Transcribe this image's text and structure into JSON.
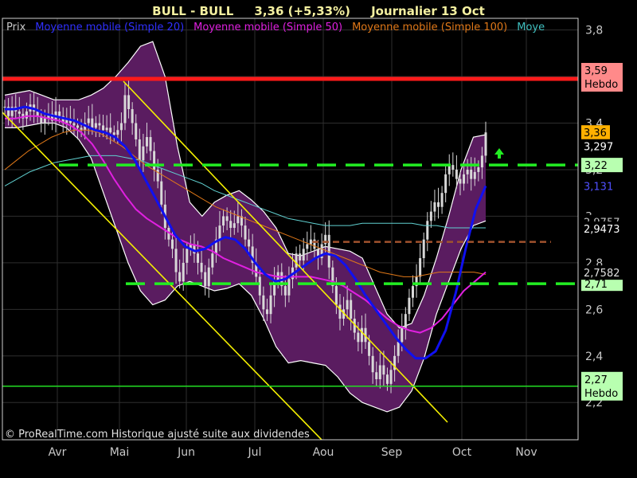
{
  "header": {
    "symbol": "BULL - BULL",
    "quote": "3,36 (+5,33%)",
    "period": "Journalier  13 Oct"
  },
  "footer": {
    "copyright": "© ProRealTime.com Historique ajusté suite aux dividendes"
  },
  "colors": {
    "background": "#000000",
    "frame": "#d0d0d0",
    "grid": "#2e2e2e",
    "band_fill": "#5a1c60",
    "band_edge": "#ffffff",
    "candle": "#d8d8d8",
    "ma20": "#1010f0",
    "ma50": "#e020e0",
    "ma100": "#e07818",
    "ma200": "#60d0d0",
    "resistance_red": "#ff1a1a",
    "support_green": "#22dd22",
    "dashed_green": "#22ee22",
    "dashed_brown": "#a0522d",
    "trend_yellow": "#f4f000"
  },
  "chart_data": {
    "type": "candlestick",
    "title": "BULL - BULL",
    "ylim": [
      2.04,
      3.85
    ],
    "y_ticks": [
      {
        "value": 3.8,
        "label": "3,8"
      },
      {
        "value": 3.6,
        "label": "3,6"
      },
      {
        "value": 3.4,
        "label": "3,4"
      },
      {
        "value": 3.2,
        "label": "3,2"
      },
      {
        "value": 3.0,
        "label": "3"
      },
      {
        "value": 2.8,
        "label": "2,8"
      },
      {
        "value": 2.6,
        "label": "2,6"
      },
      {
        "value": 2.4,
        "label": "2,4"
      },
      {
        "value": 2.2,
        "label": "2,2"
      }
    ],
    "x_ticks": [
      "Avr",
      "Mai",
      "Jun",
      "Jul",
      "Aou",
      "Sep",
      "Oct",
      "Nov"
    ],
    "legend": [
      {
        "label": "Prix",
        "color": "#c8c8c8"
      },
      {
        "label": "Moyenne mobile (Simple 20)",
        "color": "#3030ff"
      },
      {
        "label": "Moyenne mobile (Simple 50)",
        "color": "#e020e0"
      },
      {
        "label": "Moyenne mobile (Simple 100)",
        "color": "#e07818"
      },
      {
        "label": "Moye",
        "color": "#40c0c0"
      }
    ],
    "series": [
      {
        "name": "Prix",
        "close": [
          3.47,
          3.43,
          3.47,
          3.45,
          3.44,
          3.42,
          3.45,
          3.48,
          3.45,
          3.43,
          3.4,
          3.42,
          3.44,
          3.41,
          3.45,
          3.43,
          3.4,
          3.42,
          3.4,
          3.39,
          3.38,
          3.37,
          3.4,
          3.42,
          3.38,
          3.4,
          3.39,
          3.37,
          3.38,
          3.36,
          3.35,
          3.37,
          3.4,
          3.52,
          3.46,
          3.4,
          3.33,
          3.24,
          3.3,
          3.34,
          3.28,
          3.2,
          3.15,
          3.05,
          2.95,
          2.9,
          2.86,
          2.76,
          2.72,
          2.8,
          2.86,
          2.88,
          2.84,
          2.8,
          2.76,
          2.7,
          2.78,
          2.84,
          2.9,
          2.96,
          3.0,
          2.98,
          2.95,
          2.97,
          3.0,
          2.96,
          2.9,
          2.87,
          2.8,
          2.74,
          2.66,
          2.6,
          2.58,
          2.66,
          2.72,
          2.76,
          2.7,
          2.66,
          2.73,
          2.78,
          2.84,
          2.81,
          2.86,
          2.88,
          2.9,
          2.86,
          2.82,
          2.88,
          2.92,
          2.78,
          2.7,
          2.62,
          2.56,
          2.6,
          2.64,
          2.56,
          2.5,
          2.46,
          2.52,
          2.46,
          2.4,
          2.33,
          2.3,
          2.36,
          2.32,
          2.28,
          2.34,
          2.4,
          2.46,
          2.52,
          2.58,
          2.65,
          2.7,
          2.74,
          2.82,
          2.9,
          2.98,
          3.02,
          3.06,
          3.04,
          3.1,
          3.18,
          3.22,
          3.2,
          3.16,
          3.14,
          3.18,
          3.2,
          3.16,
          3.19,
          3.21,
          3.26,
          3.36
        ]
      },
      {
        "name": "Moyenne mobile (Simple 20)",
        "values": [
          3.46,
          3.46,
          3.47,
          3.46,
          3.44,
          3.43,
          3.42,
          3.41,
          3.39,
          3.37,
          3.36,
          3.34,
          3.3,
          3.24,
          3.16,
          3.08,
          3.0,
          2.92,
          2.87,
          2.85,
          2.86,
          2.89,
          2.91,
          2.9,
          2.86,
          2.8,
          2.75,
          2.72,
          2.73,
          2.76,
          2.79,
          2.82,
          2.84,
          2.83,
          2.79,
          2.73,
          2.66,
          2.6,
          2.54,
          2.48,
          2.43,
          2.39,
          2.39,
          2.42,
          2.51,
          2.67,
          2.86,
          3.03,
          3.13
        ]
      },
      {
        "name": "Moyenne mobile (Simple 50)",
        "values": [
          3.42,
          3.42,
          3.43,
          3.43,
          3.42,
          3.41,
          3.39,
          3.36,
          3.31,
          3.24,
          3.16,
          3.09,
          3.03,
          2.99,
          2.96,
          2.93,
          2.9,
          2.88,
          2.87,
          2.85,
          2.82,
          2.8,
          2.78,
          2.76,
          2.75,
          2.74,
          2.74,
          2.74,
          2.74,
          2.73,
          2.72,
          2.7,
          2.67,
          2.64,
          2.6,
          2.56,
          2.53,
          2.51,
          2.5,
          2.52,
          2.56,
          2.62,
          2.68,
          2.72,
          2.76
        ]
      },
      {
        "name": "Moyenne mobile (Simple 100)",
        "values": [
          3.2,
          3.24,
          3.28,
          3.31,
          3.34,
          3.36,
          3.37,
          3.37,
          3.36,
          3.33,
          3.3,
          3.26,
          3.22,
          3.19,
          3.16,
          3.13,
          3.1,
          3.07,
          3.04,
          3.02,
          3.0,
          2.98,
          2.96,
          2.94,
          2.92,
          2.9,
          2.88,
          2.86,
          2.84,
          2.82,
          2.8,
          2.78,
          2.76,
          2.75,
          2.74,
          2.74,
          2.75,
          2.76,
          2.76,
          2.76,
          2.76,
          2.75
        ]
      },
      {
        "name": "Moye",
        "values": [
          3.13,
          3.16,
          3.19,
          3.21,
          3.23,
          3.24,
          3.25,
          3.26,
          3.26,
          3.26,
          3.25,
          3.24,
          3.22,
          3.2,
          3.18,
          3.16,
          3.14,
          3.11,
          3.09,
          3.07,
          3.05,
          3.03,
          3.01,
          2.99,
          2.98,
          2.97,
          2.96,
          2.96,
          2.96,
          2.97,
          2.97,
          2.97,
          2.97,
          2.97,
          2.96,
          2.96,
          2.95,
          2.95,
          2.95,
          2.95
        ]
      },
      {
        "name": "Bollinger upper",
        "values": [
          3.52,
          3.53,
          3.54,
          3.52,
          3.5,
          3.5,
          3.5,
          3.52,
          3.55,
          3.6,
          3.66,
          3.73,
          3.75,
          3.6,
          3.3,
          3.06,
          3.0,
          3.06,
          3.09,
          3.11,
          3.07,
          3.02,
          2.95,
          2.84,
          2.83,
          2.85,
          2.87,
          2.86,
          2.85,
          2.82,
          2.7,
          2.58,
          2.52,
          2.54,
          2.66,
          2.82,
          3.0,
          3.2,
          3.34,
          3.35
        ]
      },
      {
        "name": "Bollinger lower",
        "values": [
          3.38,
          3.38,
          3.39,
          3.4,
          3.4,
          3.38,
          3.33,
          3.25,
          3.1,
          2.95,
          2.8,
          2.68,
          2.62,
          2.64,
          2.7,
          2.72,
          2.7,
          2.68,
          2.69,
          2.71,
          2.66,
          2.56,
          2.44,
          2.37,
          2.38,
          2.37,
          2.36,
          2.31,
          2.24,
          2.2,
          2.18,
          2.16,
          2.18,
          2.25,
          2.39,
          2.58,
          2.72,
          2.86,
          2.96,
          2.98
        ]
      }
    ],
    "levels": [
      {
        "name": "resistance-hebdo",
        "value": 3.59,
        "label": "3,59",
        "sub": "Hebdo",
        "style": "solid-red"
      },
      {
        "name": "support-hebdo",
        "value": 2.27,
        "label": "2,27",
        "sub": "Hebdo",
        "style": "solid-green"
      },
      {
        "name": "dashed-upper",
        "value": 3.22,
        "label": "3,22",
        "style": "dashed-green"
      },
      {
        "name": "dashed-lower",
        "value": 2.71,
        "label": "2,71",
        "style": "dashed-green"
      },
      {
        "name": "dashed-mid",
        "value": 2.89,
        "style": "dashed-brown"
      }
    ],
    "price_tags": [
      {
        "name": "last-price",
        "value": 3.36,
        "label": "3,36",
        "fg": "#000000",
        "bg": "#ffb000"
      },
      {
        "name": "ma-boll-upper",
        "value": 3.3,
        "label": "3,297",
        "fg": "#ffffff",
        "bg": "#000000"
      },
      {
        "name": "ma20-value",
        "value": 3.13,
        "label": "3,131",
        "fg": "#5050ff",
        "bg": "#000000"
      },
      {
        "name": "ma200-prev",
        "value": 2.975,
        "label": "2,9757",
        "fg": "#c0c0c0",
        "bg": "#000000"
      },
      {
        "name": "ma200-value",
        "value": 2.947,
        "label": "2,9473",
        "fg": "#ffffff",
        "bg": "#000000"
      },
      {
        "name": "ma100-value",
        "value": 2.758,
        "label": "2,7582",
        "fg": "#e0e0e0",
        "bg": "#000000"
      }
    ]
  }
}
